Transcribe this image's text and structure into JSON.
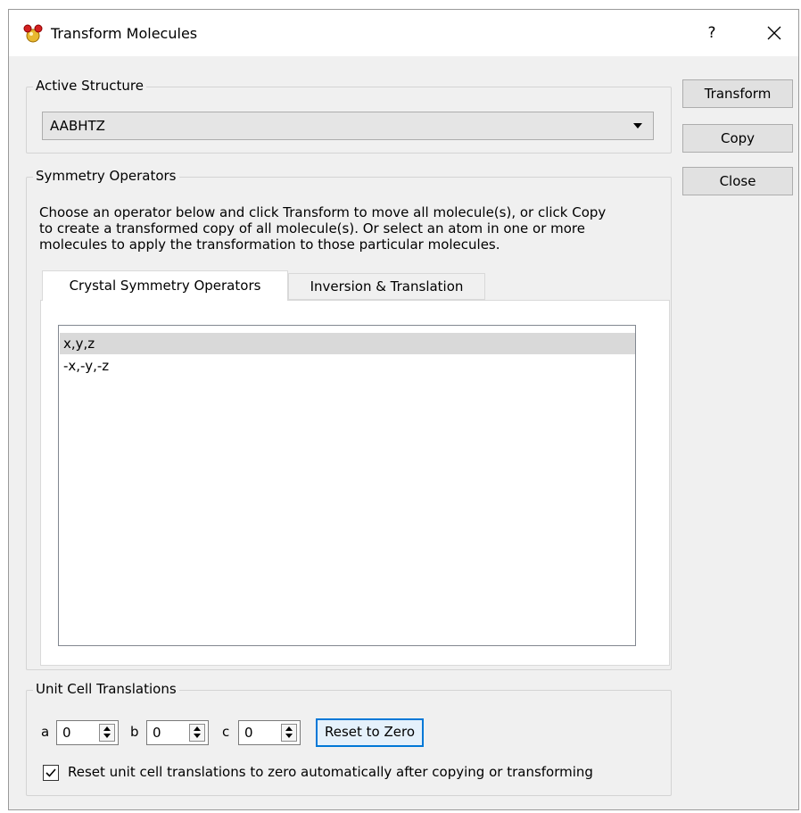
{
  "window": {
    "title": "Transform Molecules",
    "help_label": "?",
    "app_icon": "molecule-icon",
    "close_icon": "close-icon"
  },
  "active_structure": {
    "group_label": "Active Structure",
    "selected": "AABHTZ"
  },
  "buttons": {
    "transform": "Transform",
    "copy": "Copy",
    "close": "Close"
  },
  "symmetry": {
    "group_label": "Symmetry Operators",
    "description_lines": [
      "Choose an operator below and click Transform to move all molecule(s), or click Copy",
      "to create a transformed copy of all molecule(s). Or select an atom in one or more",
      "molecules to apply the transformation to those particular molecules."
    ],
    "tabs": [
      {
        "label": "Crystal Symmetry Operators",
        "active": true
      },
      {
        "label": "Inversion & Translation",
        "active": false
      }
    ],
    "operators": [
      {
        "label": "x,y,z",
        "selected": true
      },
      {
        "label": "-x,-y,-z",
        "selected": false
      }
    ]
  },
  "unit_cell": {
    "group_label": "Unit Cell Translations",
    "a_label": "a",
    "a_value": "0",
    "b_label": "b",
    "b_value": "0",
    "c_label": "c",
    "c_value": "0",
    "reset_label": "Reset to Zero",
    "auto_reset_label": "Reset unit cell translations to zero automatically after copying or transforming",
    "auto_reset_checked": true
  },
  "colors": {
    "dialog_bg": "#f0f0f0",
    "focus_border": "#0078d7",
    "selection_bg": "#d9d9d9"
  }
}
